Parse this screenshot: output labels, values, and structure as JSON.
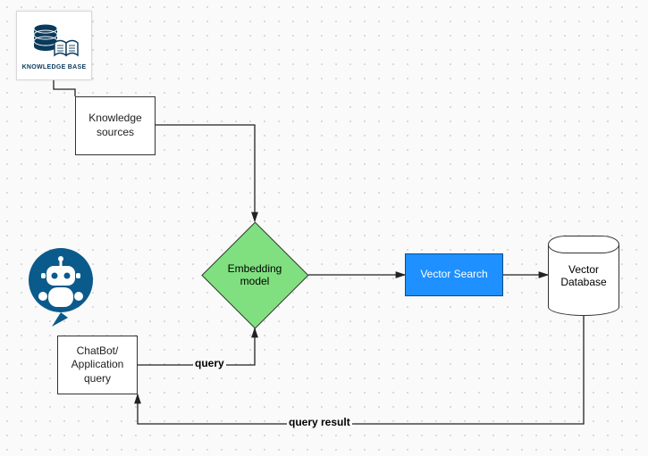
{
  "kb_icon": {
    "caption": "KNOWLEDGE BASE"
  },
  "nodes": {
    "knowledge_sources": {
      "label": "Knowledge sources"
    },
    "embedding": {
      "label": "Embedding model"
    },
    "vector_search": {
      "label": "Vector Search"
    },
    "vector_db": {
      "label": "Vector Database"
    },
    "chatbot": {
      "label": "ChatBot/ Application query"
    }
  },
  "edges": {
    "query": {
      "label": "query"
    },
    "query_result": {
      "label": "query result"
    }
  }
}
